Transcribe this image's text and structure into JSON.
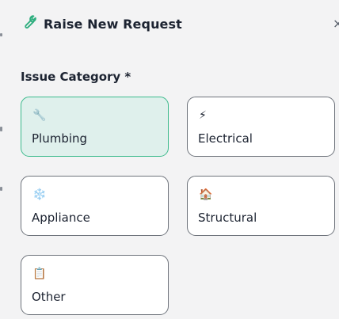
{
  "modal": {
    "title": "Raise New Request",
    "close_glyph": "×",
    "title_icon": "wrench-icon",
    "accent_color": "#3dbb8d"
  },
  "issue_category": {
    "label": "Issue Category *",
    "selected": "Plumbing",
    "options": [
      {
        "label": "Plumbing",
        "emoji": "🔧",
        "icon": "wrench-icon"
      },
      {
        "label": "Electrical",
        "emoji": "⚡",
        "icon": "lightning-icon"
      },
      {
        "label": "Appliance",
        "emoji": "❄️",
        "icon": "snowflake-icon"
      },
      {
        "label": "Structural",
        "emoji": "🏠",
        "icon": "house-icon"
      },
      {
        "label": "Other",
        "emoji": "📋",
        "icon": "clipboard-icon"
      }
    ]
  }
}
